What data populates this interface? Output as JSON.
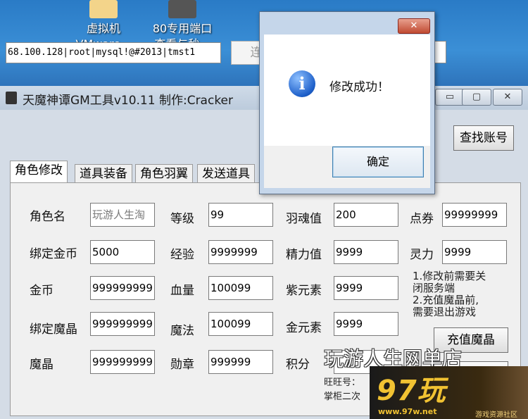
{
  "desktop": {
    "icons": [
      {
        "icon": "vmware-icon",
        "line1": "虚拟机",
        "line2": "VMware..."
      },
      {
        "icon": "port-icon",
        "line1": "80专用端口",
        "line2": "查看与秒..."
      }
    ]
  },
  "window": {
    "title": "天魔神谭GM工具v10.11  制作:Cracker",
    "controls": {
      "minimize": "▭",
      "maximize": "▢",
      "close": "✕"
    },
    "connection_string": "68.100.128|root|mysql!@#2013|tmst1",
    "connect_label": "连",
    "find_account_label": "查找账号",
    "tabs": [
      "角色修改",
      "道具装备",
      "角色羽翼",
      "发送道具"
    ],
    "fields": {
      "role_name": {
        "label": "角色名",
        "value": "玩游人生淘"
      },
      "level": {
        "label": "等级",
        "value": "99"
      },
      "feather_soul": {
        "label": "羽魂值",
        "value": "200"
      },
      "points": {
        "label": "点券",
        "value": "99999999"
      },
      "bound_gold": {
        "label": "绑定金币",
        "value": "5000"
      },
      "experience": {
        "label": "经验",
        "value": "9999999"
      },
      "energy": {
        "label": "精力值",
        "value": "9999"
      },
      "spirit": {
        "label": "灵力",
        "value": "9999"
      },
      "gold": {
        "label": "金币",
        "value": "999999999"
      },
      "hp": {
        "label": "血量",
        "value": "100099"
      },
      "purple_element": {
        "label": "紫元素",
        "value": "9999"
      },
      "bound_crystal": {
        "label": "绑定魔晶",
        "value": "999999999"
      },
      "mp": {
        "label": "魔法",
        "value": "100099"
      },
      "gold_element": {
        "label": "金元素",
        "value": "9999"
      },
      "crystal": {
        "label": "魔晶",
        "value": "999999999"
      },
      "medal": {
        "label": "勋章",
        "value": "999999"
      },
      "score": {
        "label": "积分",
        "value": ""
      }
    },
    "notes": [
      "1.修改前需要关",
      "闭服务端",
      "2.充值魔晶前,",
      "需要退出游戏"
    ],
    "recharge_label": "充值魔晶"
  },
  "dialog": {
    "close_label": "✕",
    "icon": "info-icon",
    "message": "修改成功！",
    "ok_label": "确定"
  },
  "watermark": {
    "title": "玩游人生网单店",
    "line1": "旺旺号：",
    "line2": "掌柜二次"
  },
  "logo": {
    "number": "97玩",
    "url": "www.97w.net",
    "tagline": "游戏资源社区"
  }
}
